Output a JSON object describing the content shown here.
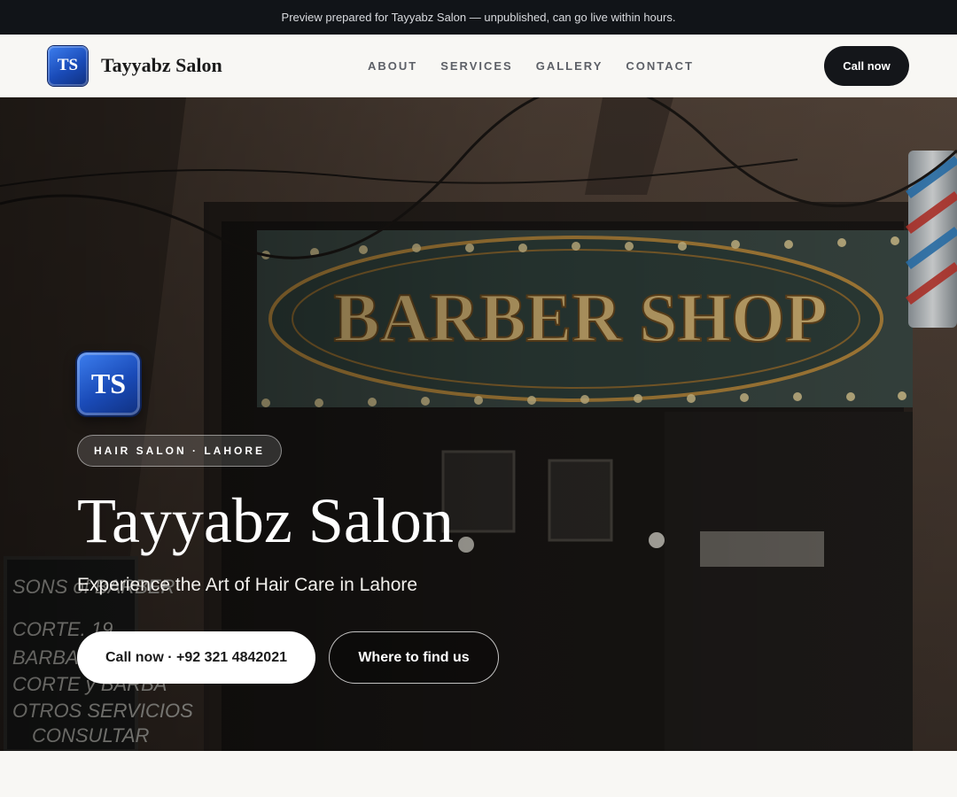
{
  "preview_banner": "Preview prepared for Tayyabz Salon — unpublished, can go live within hours.",
  "header": {
    "logo_initials": "TS",
    "brand_name": "Tayyabz Salon",
    "nav": [
      "ABOUT",
      "SERVICES",
      "GALLERY",
      "CONTACT"
    ],
    "cta_label": "Call now"
  },
  "hero": {
    "logo_initials": "TS",
    "tag": "HAIR SALON · LAHORE",
    "title": "Tayyabz Salon",
    "subtitle": "Experience the Art of Hair Care in Lahore",
    "primary_button": "Call now · +92 321 4842021",
    "secondary_button": "Where to find us",
    "background_image": {
      "sign_text": "BARBER SHOP",
      "chalkboard_lines": [
        "SONS of BARBER",
        "CORTE. 19",
        "BARBA.",
        "CORTE y BARBA",
        "OTROS SERVICIOS",
        "CONSULTAR"
      ]
    }
  },
  "colors": {
    "dark": "#14161a",
    "accent_blue": "#1a4bb8",
    "page_bg": "#f8f7f4"
  }
}
